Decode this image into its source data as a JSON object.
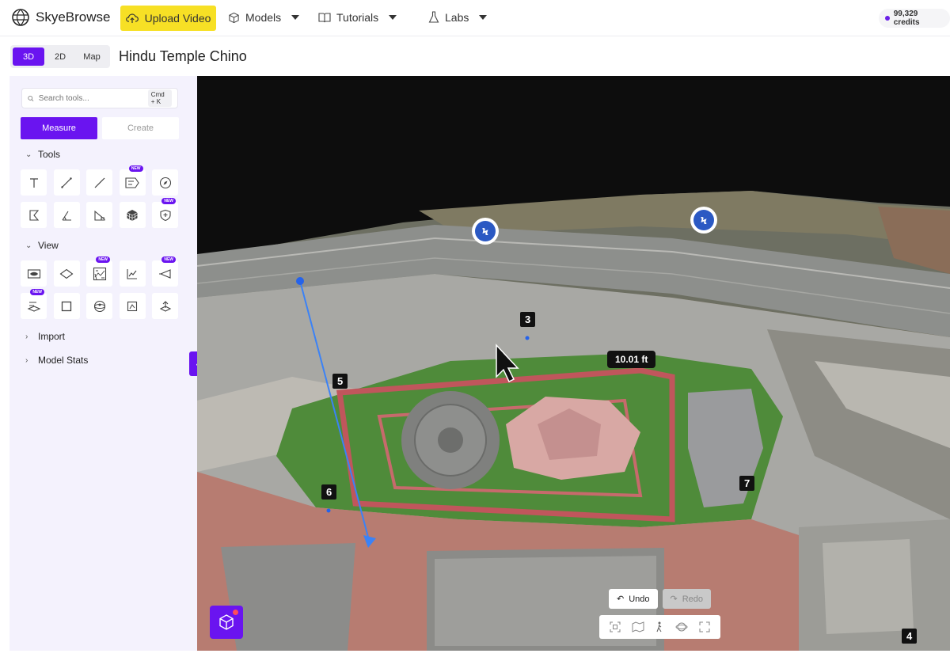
{
  "header": {
    "logo_text": "SkyeBrowse",
    "upload_label": "Upload Video",
    "nav": [
      {
        "label": "Models",
        "icon": "cube-outline-icon"
      },
      {
        "label": "Tutorials",
        "icon": "book-icon"
      },
      {
        "label": "Labs",
        "icon": "flask-icon"
      }
    ],
    "credits": "99,329 credits"
  },
  "view_tabs": [
    "3D",
    "2D",
    "Map"
  ],
  "active_view": "3D",
  "page_title": "Hindu Temple Chino",
  "sidebar": {
    "search_placeholder": "Search tools...",
    "search_shortcut": "Cmd + K",
    "mode_tabs": {
      "measure": "Measure",
      "create": "Create"
    },
    "sections": {
      "tools": "Tools",
      "view": "View",
      "import": "Import",
      "model_stats": "Model Stats"
    },
    "badge_new": "NEW",
    "tools_icons": [
      "text-icon",
      "distance-line-icon",
      "line-icon",
      "annotation-icon",
      "compass-icon",
      "area-icon",
      "angle-icon",
      "slope-icon",
      "volume-icon",
      "shield-icon"
    ],
    "view_icons": [
      "eye-icon",
      "plane-icon",
      "texture-icon",
      "elevation-chart-icon",
      "viewpoint-icon",
      "section-icon",
      "crop-box-icon",
      "panorama-360-icon",
      "bounding-box-icon",
      "pivot-icon"
    ]
  },
  "viewport": {
    "point_labels": [
      "3",
      "5",
      "6",
      "7",
      "4"
    ],
    "measurement": "10.01 ft",
    "undo_label": "Undo",
    "redo_label": "Redo",
    "toolbar_icons": [
      "focus-icon",
      "map-fold-icon",
      "walk-icon",
      "orbit-icon",
      "fullscreen-icon"
    ]
  },
  "colors": {
    "accent": "#6a14f0",
    "upload": "#f7e025"
  }
}
